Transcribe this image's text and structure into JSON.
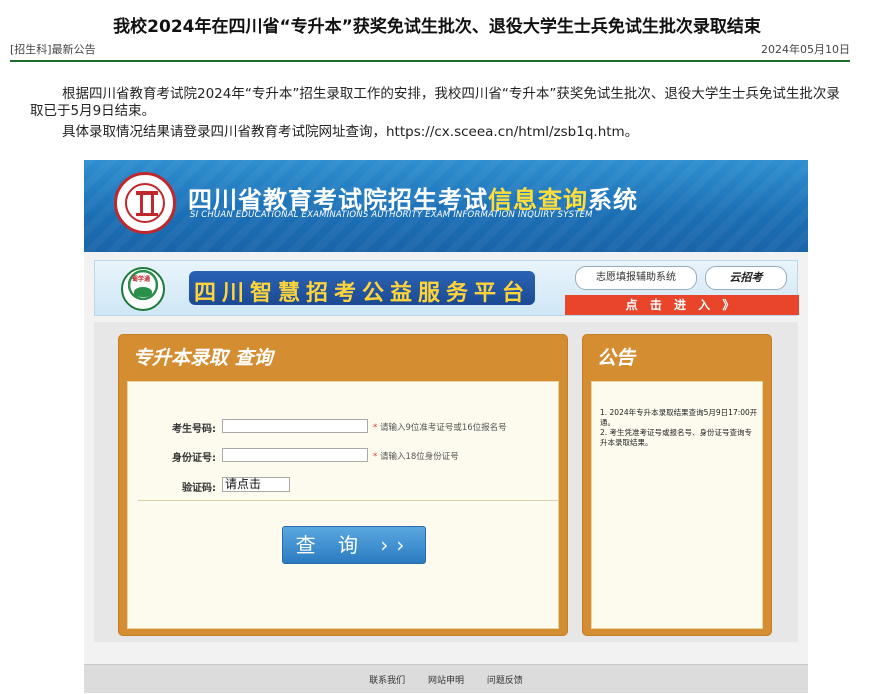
{
  "article": {
    "title": "我校2024年在四川省“专升本”获奖免试生批次、退役大学生士兵免试生批次录取结束",
    "category": "[招生科]最新公告",
    "date": "2024年05月10日",
    "paragraph1": "根据四川省教育考试院2024年“专升本”招生录取工作的安排，我校四川省“专升本”获奖免试生批次、退役大学生士兵免试生批次录取已于5月9日结束。",
    "paragraph2": "具体录取情况结果请登录四川省教育考试院网址查询，https://cx.sceea.cn/html/zsb1q.htm。"
  },
  "screenshot": {
    "banner": {
      "title_main": "四川省教育考试院招生考试",
      "title_highlight": "信息查询",
      "title_end": "系统",
      "subtitle": "SI CHUAN EDUCATIONAL EXAMINATIONS AUTHORITY EXAM INFORMATION INQUIRY SYSTEM"
    },
    "platform": {
      "logo_text": "蜀学通",
      "name": "四川智慧招考公益服务平台",
      "btn_volunteer": "志愿填报辅助系统",
      "btn_brand": "云招考",
      "enter": "点 击 进 入 》"
    },
    "form": {
      "title": "专升本录取 查询",
      "exam_no_label": "考生号码:",
      "exam_no_hint": "请输入9位准考证号或16位报名号",
      "id_label": "身份证号:",
      "id_hint": "请输入18位身份证号",
      "star": "*",
      "captcha_label": "验证码:",
      "captcha_value": "请点击",
      "query_button": "查 询 ››"
    },
    "notice": {
      "title": "公告",
      "line1": "1. 2024年专升本录取结果查询5月9日17:00开通。",
      "line2": "2. 考生凭准考证号或报名号、身份证号查询专升本录取结果。"
    },
    "footer": {
      "contact": "联系我们",
      "statement": "网站申明",
      "feedback": "问题反馈"
    }
  }
}
